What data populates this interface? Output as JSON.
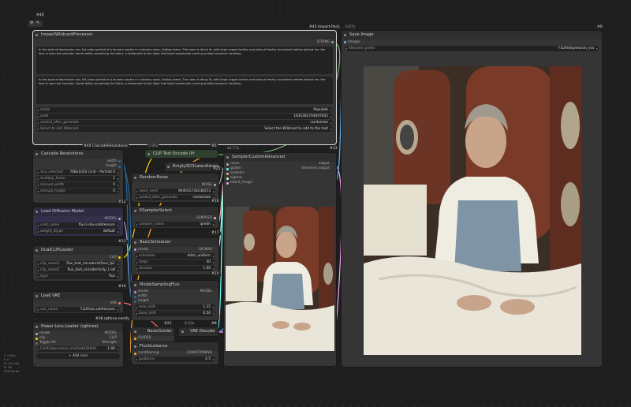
{
  "left_stats": [
    "T: 0.00s",
    "I: 0",
    "N: 24 [18]",
    "V: 28",
    "FPS:38.46"
  ],
  "colors": {
    "model": "#b39ddb",
    "clip": "#ffd500",
    "vae": "#ff6e6e",
    "latent": "#ff9cf9",
    "image": "#64b5f6",
    "conditioning": "#ffa931",
    "int": "#29699c",
    "sampler": "#ecb4b4",
    "sigmas": "#cdffcd",
    "noise": "#b0b0b0",
    "guider": "#66ffff",
    "string": "#7ab87a"
  },
  "nodes": {
    "group_id": "#40",
    "impact": {
      "id": "#42 Impact-Pack",
      "title": "ImpactWildcardProcessor",
      "output_label": "STRING",
      "text1": "In the style of depression era, full-color portrait of a laundry worker in a steamy room, folding linens. The room is dimly lit, with large copper boilers and piles of freshly laundered clothes behind her. Her face is worn but resolute, hands deftly smoothing the fabric, a testament to the labor that kept households running amidst economic hardship.",
      "text2": "In the style of depression era, full-color portrait of a laundry worker in a steamy room, folding linens. The room is dimly lit, with large copper boilers and piles of freshly laundered clothes behind her. Her face is worn but resolute, hands deftly smoothing the fabric, a testament to the labor that kept households running amidst economic hardship.",
      "mode_label": "mode",
      "mode_value": "Populate",
      "seed_label": "seed",
      "seed_value": "1635362704697602",
      "control_label": "control_after_generate",
      "control_value": "randomize",
      "wildcard_label": "Select to add Wildcard",
      "wildcard_value": "Select the Wildcard to add to the text"
    },
    "save": {
      "id": "#9",
      "tab": "0.67s",
      "title": "Save Image",
      "input": "images",
      "prefix_label": "filename_prefix",
      "prefix_value": "FLUX/depression_era"
    },
    "cascade": {
      "id": "#44 CascadeResolutions",
      "title": "Cascade Resolutions",
      "outs": [
        "width",
        "height"
      ],
      "size_label": "size_selected",
      "size_value": "768x1024 (3:4) - Portrait S",
      "mult_label": "multiply_factor",
      "mult_value": "1",
      "mw_label": "manual_width",
      "mw_value": "0",
      "mh_label": "manual_height",
      "mh_value": "0",
      "badge": "#12"
    },
    "clip_text": {
      "tab": "0.80s",
      "title": "CLIP Text Encode (Pr",
      "id": "#6"
    },
    "empty_latent": {
      "title": "EmptySD3LatentImage",
      "id": "#25"
    },
    "random_noise": {
      "title": "RandomNoise",
      "out": "NOISE",
      "seed_label": "noise_seed",
      "seed_value": "964031730238253",
      "ctrl_label": "control_after_generate",
      "ctrl_value": "randomize",
      "badge": "#16"
    },
    "ksampler_select": {
      "title": "KSamplerSelect",
      "out": "SAMPLER",
      "sampler_label": "sampler_name",
      "sampler_value": "ipndm",
      "badge": "#17"
    },
    "basic_scheduler": {
      "title": "BasicScheduler",
      "in_model": "model",
      "out": "SIGMAS",
      "sched_label": "scheduler",
      "sched_value": "ddim_uniform",
      "steps_label": "steps",
      "steps_value": "40",
      "denoise_label": "denoise",
      "denoise_value": "1.00",
      "badge": "#10"
    },
    "model_sampling": {
      "title": "ModelSamplingFlux",
      "ins": [
        "model",
        "width",
        "height"
      ],
      "out": "MODEL",
      "max_label": "max_shift",
      "max_value": "1.15",
      "base_label": "base_shift",
      "base_value": "0.50",
      "badge": "#30 rgthree-comfy"
    },
    "basic_guider": {
      "title": "BasicGuider",
      "id": "#22",
      "ins": [
        "model",
        "conditioning"
      ],
      "out": "GUIDER"
    },
    "vae_decode": {
      "tab": "0.33s",
      "title": "VAE Decode",
      "id": "#8"
    },
    "flux_guidance": {
      "title": "FluxGuidance",
      "in": "conditioning",
      "out": "CONDITIONING",
      "g_label": "guidance",
      "g_value": "4.5"
    },
    "sampler_adv": {
      "tab": "44.77s",
      "title": "SamplerCustomAdvanced",
      "id": "#13",
      "ins": [
        "noise",
        "guider",
        "sampler",
        "sigmas",
        "latent_image"
      ],
      "outs": [
        "output",
        "denoised_output"
      ]
    },
    "load_diffusion": {
      "title": "Load Diffusion Model",
      "out": "MODEL",
      "unet_label": "unet_name",
      "unet_value": "flux1-dev.safetensors",
      "dtype_label": "weight_dtype",
      "dtype_value": "default",
      "badge": "#11"
    },
    "dual_clip": {
      "title": "DualCLIPLoader",
      "out": "CLIP",
      "c1_label": "clip_name1",
      "c1_value": "flux_text_encoders\\t5xxl_fp1",
      "c2_label": "clip_name2",
      "c2_value": "flux_text_encoders\\clip_l.saf",
      "type_label": "type",
      "type_value": "flux",
      "badge": "#10"
    },
    "load_vae": {
      "title": "Load VAE",
      "out": "VAE",
      "vae_label": "vae_name",
      "vae_value": "FLUX\\ae.safetensors",
      "badge": "#38 rgthree-comfy"
    },
    "lora": {
      "title": "Power Lora Loader (rgthree)",
      "ins": [
        "model",
        "clip"
      ],
      "outs": [
        "MODEL",
        "CLIP"
      ],
      "toggle_label": "Toggle All",
      "strength_label": "Strength",
      "lora_value": "FLUX\\depression_era\\5ed4266d9.",
      "lora_strength": "1.00",
      "add_label": "+ Add Lora"
    }
  }
}
